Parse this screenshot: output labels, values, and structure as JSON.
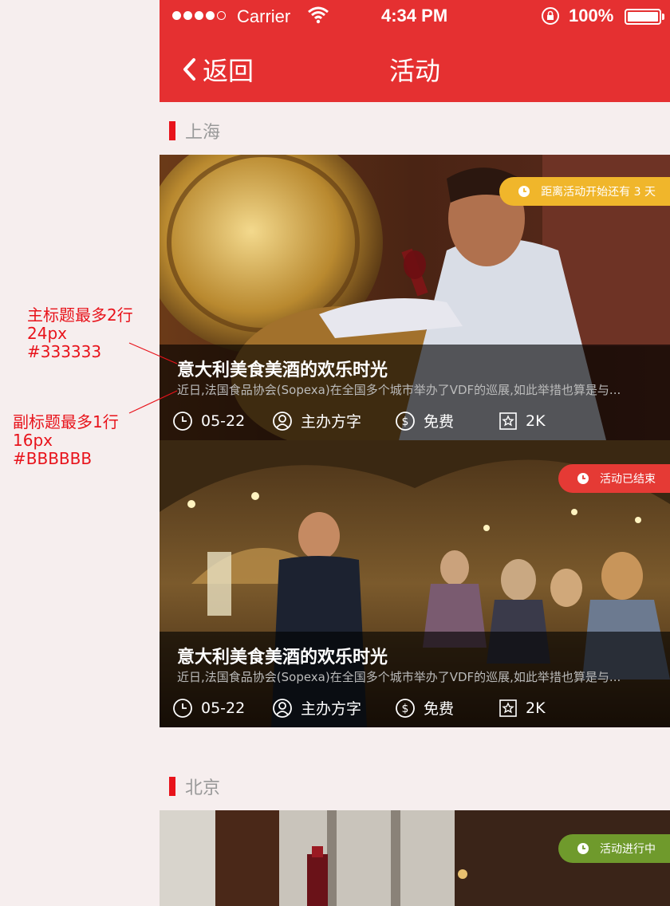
{
  "annotations": {
    "title_note": [
      "主标题最多2行",
      "24px",
      "#333333"
    ],
    "subtitle_note": [
      "副标题最多1行",
      "16px",
      "#BBBBBB"
    ]
  },
  "status_bar": {
    "carrier": "Carrier",
    "time": "4:34 PM",
    "battery": "100%"
  },
  "nav": {
    "back_label": "返回",
    "title": "活动"
  },
  "sections": [
    {
      "city": "上海",
      "cards": [
        {
          "badge": "距离活动开始还有 3 天",
          "badge_color": "#f0b62b",
          "title": "意大利美食美酒的欢乐时光",
          "subtitle": "近日,法国食品协会(Sopexa)在全国多个城市举办了VDF的巡展,如此举措也算是与...",
          "date": "05-22",
          "organizer": "主办方字",
          "price": "免费",
          "favorites": "2K"
        },
        {
          "badge": "活动已结束",
          "badge_color": "#e53a35",
          "title": "意大利美食美酒的欢乐时光",
          "subtitle": "近日,法国食品协会(Sopexa)在全国多个城市举办了VDF的巡展,如此举措也算是与...",
          "date": "05-22",
          "organizer": "主办方字",
          "price": "免费",
          "favorites": "2K"
        }
      ]
    },
    {
      "city": "北京",
      "cards": [
        {
          "badge": "活动进行中",
          "badge_color": "#6f9a2c"
        }
      ]
    }
  ]
}
